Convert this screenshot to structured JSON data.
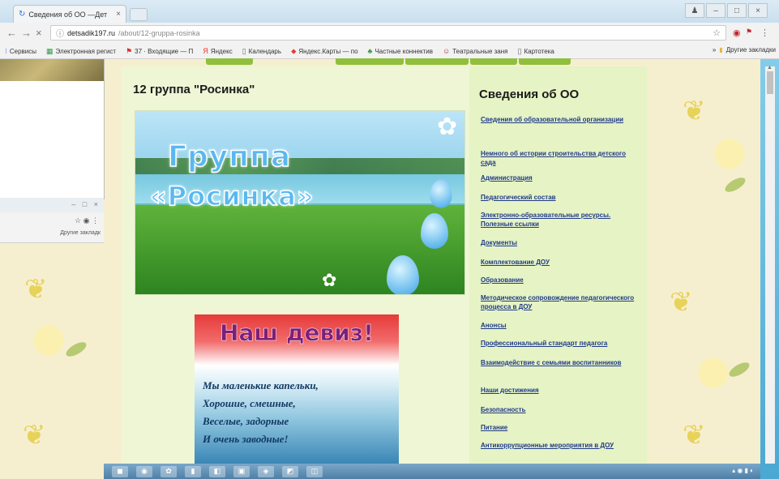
{
  "browser": {
    "tab_title": "Сведения об ОО —Дет",
    "tab_close": "×",
    "url_host": "detsadik197.ru",
    "url_path": "/about/12-gruppa-rosinka",
    "bookmarks": [
      {
        "icon": "apps-icon",
        "label": "Сервисы"
      },
      {
        "icon": "sheet-icon",
        "label": "Электронная регист"
      },
      {
        "icon": "flag-icon",
        "label": "37 · Входящие — П"
      },
      {
        "icon": "yandex-icon",
        "label": "Яндекс"
      },
      {
        "icon": "page-icon",
        "label": "Календарь"
      },
      {
        "icon": "map-pin-icon",
        "label": "Яндекс.Карты — по"
      },
      {
        "icon": "leaf-icon",
        "label": "Частные коннектив"
      },
      {
        "icon": "theatre-icon",
        "label": "Театральные заня"
      },
      {
        "icon": "page-icon",
        "label": "Картотека"
      }
    ],
    "other_bookmarks": "Другие закладки",
    "bg_other_bookmarks": "Другие закладк"
  },
  "page": {
    "title": "12 группа \"Росинка\"",
    "banner_line1": "Группа",
    "banner_line2": "«Росинка»",
    "motto_title": "Наш девиз!",
    "motto_lines": [
      "Мы маленькие капельки,",
      "Хорошие, смешные,",
      "Веселые, задорные",
      "И очень заводные!"
    ]
  },
  "sidebar": {
    "title": "Сведения об ОО",
    "links": [
      "Сведения об образовательной организации",
      "Немного об истории строительства детского сада",
      "Администрация",
      "Педагогический состав",
      "Электронно-образовательные ресурсы. Полезные ссылки",
      "Документы",
      "Комплектование ДОУ",
      "Образование",
      "Методическое сопровождение педагогического процесса в ДОУ",
      "Анонсы",
      "Профессиональный стандарт педагога",
      "Взаимодействие с семьями воспитанников",
      "Наши достижения",
      "Безопасность",
      "Питание",
      "Антикоррупционные мероприятия в ДОУ"
    ]
  },
  "colors": {
    "sidebar_bg": "#e6f3c4",
    "content_bg": "#eef6d6",
    "nav_green": "#8fbf3c",
    "link_color": "#1f3a8a"
  }
}
